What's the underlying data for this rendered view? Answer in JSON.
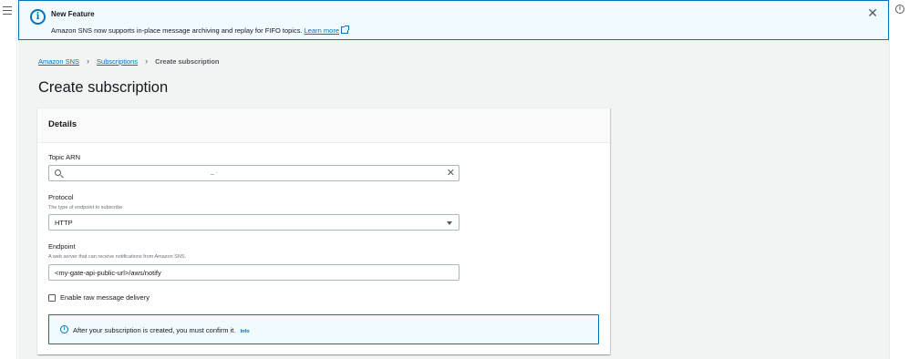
{
  "flash": {
    "title": "New Feature",
    "message": "Amazon SNS now supports in-place message archiving and replay for FIFO topics.",
    "link_text": "Learn more",
    "close_symbol": "✕",
    "icon": "info-icon"
  },
  "breadcrumb": {
    "items": [
      "Amazon SNS",
      "Subscriptions"
    ],
    "current": "Create subscription",
    "separator": "›"
  },
  "page": {
    "title": "Create subscription"
  },
  "details": {
    "header": "Details",
    "topic_arn": {
      "label": "Topic ARN",
      "value": "_     .",
      "clear_symbol": "✕"
    },
    "protocol": {
      "label": "Protocol",
      "description": "The type of endpoint to subscribe",
      "selected": "HTTP"
    },
    "endpoint": {
      "label": "Endpoint",
      "description": "A web server that can receive notifications from Amazon SNS.",
      "value": "<my-gate-api-public-url>/aws/notify"
    },
    "raw_delivery": {
      "label": "Enable raw message delivery",
      "checked": false
    },
    "alert": {
      "text": "After your subscription is created, you must confirm it.",
      "info_link": "Info"
    }
  },
  "colors": {
    "accent": "#0073bb",
    "background": "#f2f3f3",
    "flash_bg": "#f1faff"
  }
}
